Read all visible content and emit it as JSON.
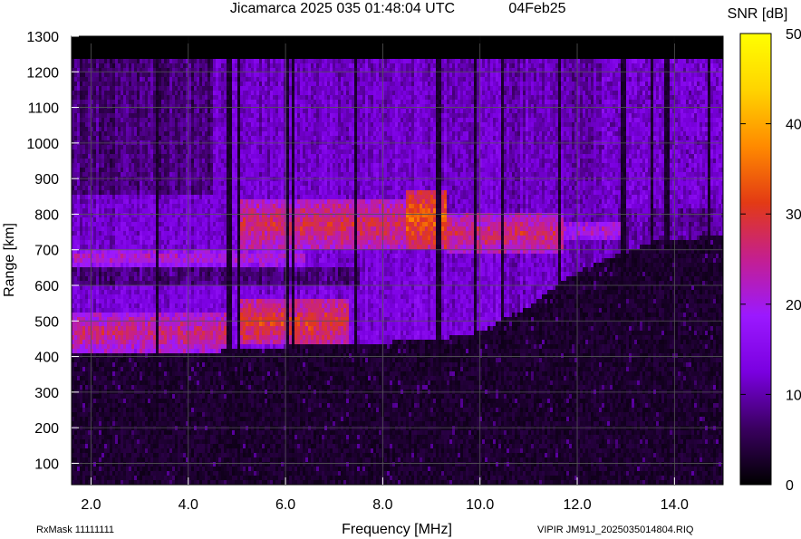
{
  "header": {
    "title": "Jicamarca 2025 035 01:48:04 UTC",
    "date": "04Feb25"
  },
  "footer": {
    "rxmask": "RxMask 11111111",
    "file": "VIPIR  JM91J_2025035014804.RIQ"
  },
  "chart_data": {
    "type": "heatmap",
    "title": "Jicamarca 2025 035 01:48:04 UTC",
    "xlabel": "Frequency [MHz]",
    "ylabel": "Range [km]",
    "xlim": [
      1.6,
      15.0
    ],
    "ylim": [
      40,
      1300
    ],
    "x_ticks": [
      "2.0",
      "4.0",
      "6.0",
      "8.0",
      "10.0",
      "12.0",
      "14.0"
    ],
    "y_ticks": [
      "100",
      "200",
      "300",
      "400",
      "500",
      "600",
      "700",
      "800",
      "900",
      "1000",
      "1100",
      "1200",
      "1300"
    ],
    "x_tick_values": [
      2,
      4,
      6,
      8,
      10,
      12,
      14
    ],
    "y_tick_values": [
      100,
      200,
      300,
      400,
      500,
      600,
      700,
      800,
      900,
      1000,
      1100,
      1200,
      1300
    ],
    "colorbar": {
      "label": "SNR [dB]",
      "range": [
        0,
        50
      ],
      "ticks": [
        "0",
        "10",
        "20",
        "30",
        "40",
        "50"
      ],
      "tick_values": [
        0,
        10,
        20,
        30,
        40,
        50
      ],
      "colors": [
        "#000000",
        "#3a0060",
        "#7a00e0",
        "#9b19ff",
        "#c41f90",
        "#e33a14",
        "#ff8a00",
        "#ffd400",
        "#ffff00"
      ]
    },
    "data_range_km": [
      40,
      1240
    ],
    "echo_onset_km": [
      {
        "f": 1.6,
        "h": 405
      },
      {
        "f": 4.0,
        "h": 405
      },
      {
        "f": 5.0,
        "h": 420
      },
      {
        "f": 7.0,
        "h": 435
      },
      {
        "f": 9.0,
        "h": 445
      },
      {
        "f": 10.0,
        "h": 470
      },
      {
        "f": 11.0,
        "h": 540
      },
      {
        "f": 12.0,
        "h": 640
      },
      {
        "f": 13.5,
        "h": 720
      },
      {
        "f": 15.0,
        "h": 740
      }
    ],
    "strong_bands": [
      {
        "f_min": 1.6,
        "f_max": 4.9,
        "h_min": 415,
        "h_max": 520,
        "snr": 26
      },
      {
        "f_min": 5.0,
        "f_max": 7.3,
        "h_min": 430,
        "h_max": 560,
        "snr": 30
      },
      {
        "f_min": 1.6,
        "f_max": 6.4,
        "h_min": 655,
        "h_max": 700,
        "snr": 22
      },
      {
        "f_min": 5.0,
        "f_max": 9.3,
        "h_min": 700,
        "h_max": 840,
        "snr": 28
      },
      {
        "f_min": 8.5,
        "f_max": 9.3,
        "h_min": 700,
        "h_max": 870,
        "snr": 34
      },
      {
        "f_min": 9.3,
        "f_max": 11.7,
        "h_min": 690,
        "h_max": 800,
        "snr": 27
      },
      {
        "f_min": 11.7,
        "f_max": 13.0,
        "h_min": 730,
        "h_max": 780,
        "snr": 22
      }
    ],
    "dark_frequency_lines": [
      3.35,
      4.8,
      4.87,
      5.05,
      6.05,
      6.15,
      7.45,
      9.15,
      9.9,
      10.45,
      11.65,
      12.95,
      13.55,
      13.85,
      14.7
    ]
  }
}
